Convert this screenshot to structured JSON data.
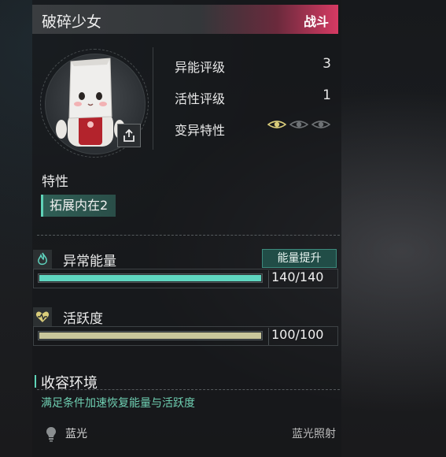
{
  "header": {
    "title": "破碎少女",
    "badge": "战斗"
  },
  "stats": [
    {
      "label": "异能评级",
      "value": "3"
    },
    {
      "label": "活性评级",
      "value": "1"
    },
    {
      "label": "变异特性",
      "value": ""
    }
  ],
  "mutation_level": {
    "active": 1,
    "total": 3
  },
  "traits": {
    "label": "特性",
    "tag": "拓展内在2"
  },
  "energy": {
    "title": "异常能量",
    "boost_label": "能量提升",
    "value_text": "140/140",
    "fill": 1.0,
    "color": "#5fd6c0"
  },
  "vitality": {
    "title": "活跃度",
    "value_text": "100/100",
    "fill": 1.0,
    "color": "#c9c79b"
  },
  "environment": {
    "title": "收容环境",
    "subtitle": "满足条件加速恢复能量与活跃度"
  },
  "light": {
    "name": "蓝光",
    "value": "蓝光照射"
  }
}
